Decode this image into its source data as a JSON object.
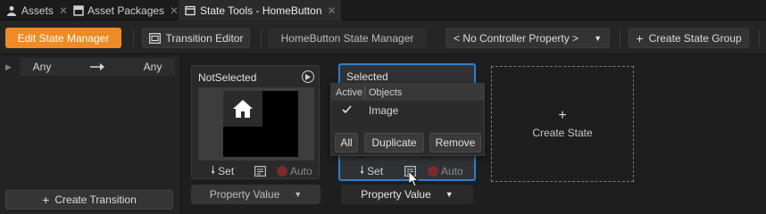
{
  "tabs": [
    {
      "label": "Assets",
      "icon": "user-icon",
      "closable": true
    },
    {
      "label": "Asset Packages",
      "icon": "package-icon",
      "closable": true
    },
    {
      "label": "State Tools - HomeButton",
      "icon": "window-icon",
      "closable": true,
      "active": true
    }
  ],
  "toolbar": {
    "edit_state_manager": "Edit State Manager",
    "transition_editor": "Transition Editor",
    "state_manager_name": "HomeButton State Manager",
    "controller_property": "< No Controller Property >",
    "create_state_group": "Create State Group"
  },
  "transitions": {
    "from": "Any",
    "to": "Any",
    "create_transition": "Create Transition"
  },
  "states": [
    {
      "title": "NotSelected",
      "set_label": "Set",
      "auto_label": "Auto",
      "property_value": "Property Value"
    },
    {
      "title": "Selected",
      "set_label": "Set",
      "auto_label": "Auto",
      "property_value": "Property Value"
    }
  ],
  "create_state": {
    "label": "Create State"
  },
  "popup": {
    "col_active": "Active",
    "col_objects": "Objects",
    "rows": [
      {
        "active": true,
        "object": "Image"
      }
    ],
    "all": "All",
    "duplicate": "Duplicate",
    "remove": "Remove"
  },
  "colors": {
    "accent": "#f08a24",
    "selection": "#2e7fd1",
    "record": "#b03030"
  }
}
